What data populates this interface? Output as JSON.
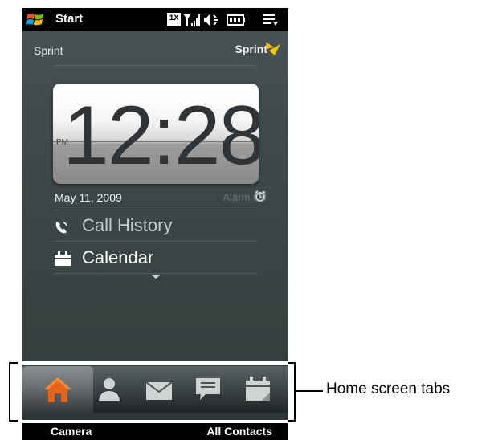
{
  "status_bar": {
    "title": "Start",
    "icons": [
      "windows-logo-icon",
      "1x-data-icon",
      "signal-strength-icon",
      "speaker-icon",
      "battery-icon",
      "menu-icon"
    ],
    "network_label": "1X"
  },
  "carrier": {
    "left": "Sprint",
    "right": "Sprint"
  },
  "clock": {
    "time": "12:28",
    "ampm": "PM"
  },
  "date": "May 11, 2009",
  "alarm": "Alarm Off",
  "items": [
    {
      "label": "Call History",
      "icon": "phone-icon"
    },
    {
      "label": "Calendar",
      "icon": "calendar-icon"
    }
  ],
  "tabs": [
    {
      "name": "home",
      "icon": "house-icon",
      "selected": true
    },
    {
      "name": "people",
      "icon": "person-icon"
    },
    {
      "name": "messages",
      "icon": "envelope-icon"
    },
    {
      "name": "sms",
      "icon": "chat-bubble-icon"
    },
    {
      "name": "calendar",
      "icon": "calendar-icon"
    }
  ],
  "softkeys": {
    "left": "Camera",
    "right": "All Contacts"
  },
  "annotation": {
    "label": "Home screen tabs"
  },
  "colors": {
    "accent_orange": "#e8631a",
    "sprint_yellow": "#f4c300"
  }
}
